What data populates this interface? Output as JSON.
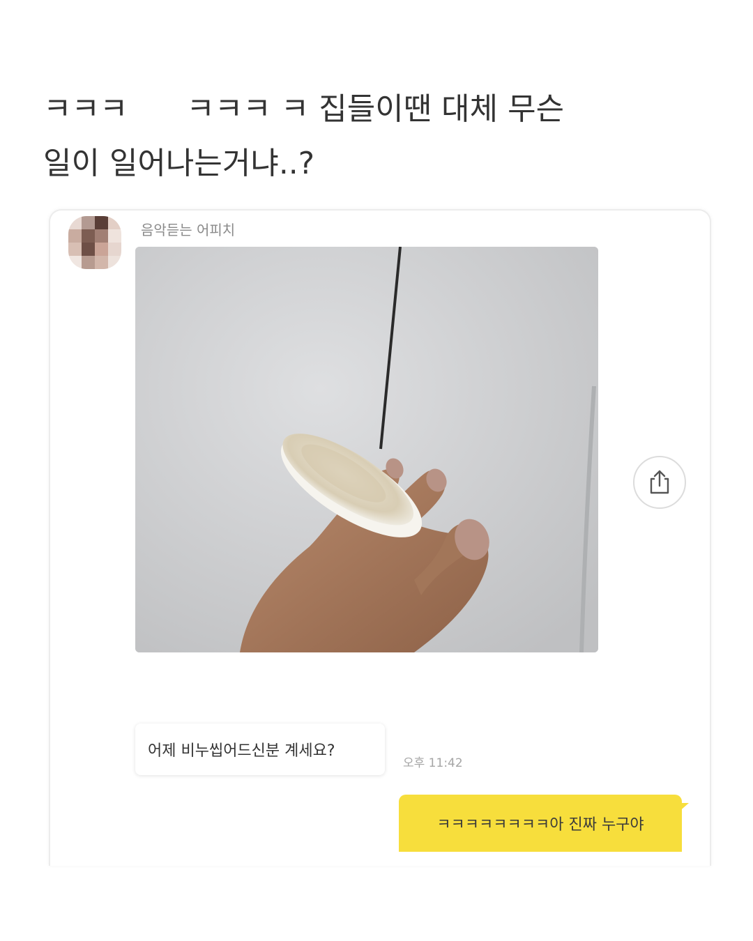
{
  "post": {
    "caption_line1": "ㅋㅋㅋ      ㅋㅋㅋ ㅋ 집들이땐 대체 무슨",
    "caption_line2": "일이 일어나는거냐..?"
  },
  "chat": {
    "sender_name": "음악듣는 어피치",
    "incoming_message": "어제 비누씹어드신분 계세요?",
    "incoming_time": "오후 11:42",
    "outgoing_message": "ㅋㅋㅋㅋㅋㅋㅋㅋ아 진짜 누구야",
    "share_icon": "share-icon",
    "colors": {
      "outgoing_bubble": "#f7de3c",
      "card_border": "#ececec",
      "timestamp": "#a5a5a5"
    }
  }
}
